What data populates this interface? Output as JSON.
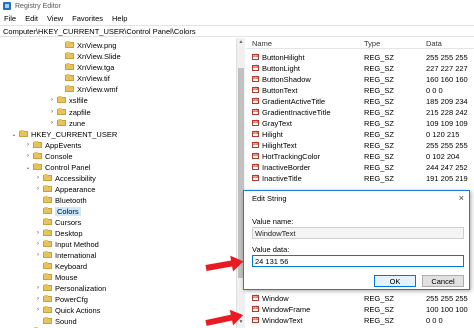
{
  "window": {
    "title": "Registry Editor",
    "accent": "#1e7bd6"
  },
  "menu": [
    "File",
    "Edit",
    "View",
    "Favorites",
    "Help"
  ],
  "address": "Computer\\HKEY_CURRENT_USER\\Control Panel\\Colors",
  "tree": [
    {
      "label": "XnView.png",
      "expand": ""
    },
    {
      "label": "XnView.Slide",
      "expand": ""
    },
    {
      "label": "XnView.tga",
      "expand": ""
    },
    {
      "label": "XnView.tif",
      "expand": ""
    },
    {
      "label": "XnView.wmf",
      "expand": ""
    },
    {
      "label": "xslfile",
      "expand": ">"
    },
    {
      "label": "zapfile",
      "expand": ">"
    },
    {
      "label": "zune",
      "expand": ">"
    },
    {
      "label": "HKEY_CURRENT_USER",
      "expand": "v"
    },
    {
      "label": "AppEvents",
      "expand": ">"
    },
    {
      "label": "Console",
      "expand": ">"
    },
    {
      "label": "Control Panel",
      "expand": "v"
    },
    {
      "label": "Accessibility",
      "expand": ">"
    },
    {
      "label": "Appearance",
      "expand": ">"
    },
    {
      "label": "Bluetooth",
      "expand": ""
    },
    {
      "label": "Colors",
      "expand": "",
      "selected": true
    },
    {
      "label": "Cursors",
      "expand": ""
    },
    {
      "label": "Desktop",
      "expand": ">"
    },
    {
      "label": "Input Method",
      "expand": ">"
    },
    {
      "label": "International",
      "expand": ">"
    },
    {
      "label": "Keyboard",
      "expand": ""
    },
    {
      "label": "Mouse",
      "expand": ""
    },
    {
      "label": "Personalization",
      "expand": ">"
    },
    {
      "label": "PowerCfg",
      "expand": ">"
    },
    {
      "label": "Quick Actions",
      "expand": ">"
    },
    {
      "label": "Sound",
      "expand": ""
    },
    {
      "label": "Environment",
      "expand": ""
    }
  ],
  "list": {
    "headers": {
      "name": "Name",
      "type": "Type",
      "data": "Data"
    },
    "rows": [
      {
        "name": "ButtonHilight",
        "type": "REG_SZ",
        "data": "255 255 255"
      },
      {
        "name": "ButtonLight",
        "type": "REG_SZ",
        "data": "227 227 227"
      },
      {
        "name": "ButtonShadow",
        "type": "REG_SZ",
        "data": "160 160 160"
      },
      {
        "name": "ButtonText",
        "type": "REG_SZ",
        "data": "0 0 0"
      },
      {
        "name": "GradientActiveTitle",
        "type": "REG_SZ",
        "data": "185 209 234"
      },
      {
        "name": "GradientInactiveTitle",
        "type": "REG_SZ",
        "data": "215 228 242"
      },
      {
        "name": "GrayText",
        "type": "REG_SZ",
        "data": "109 109 109"
      },
      {
        "name": "Hilight",
        "type": "REG_SZ",
        "data": "0 120 215"
      },
      {
        "name": "HilightText",
        "type": "REG_SZ",
        "data": "255 255 255"
      },
      {
        "name": "HotTrackingColor",
        "type": "REG_SZ",
        "data": "0 102 204"
      },
      {
        "name": "InactiveBorder",
        "type": "REG_SZ",
        "data": "244 247 252"
      },
      {
        "name": "InactiveTitle",
        "type": "REG_SZ",
        "data": "191 205 219"
      }
    ],
    "bottom_rows": [
      {
        "name": "Window",
        "type": "REG_SZ",
        "data": "255 255 255"
      },
      {
        "name": "WindowFrame",
        "type": "REG_SZ",
        "data": "100 100 100"
      },
      {
        "name": "WindowText",
        "type": "REG_SZ",
        "data": "0 0 0"
      }
    ]
  },
  "dialog": {
    "title": "Edit String",
    "close": "×",
    "value_name_label": "Value name:",
    "value_name": "WindowText",
    "value_data_label": "Value data:",
    "value_data": "24 131 56",
    "ok": "OK",
    "cancel": "Cancel"
  },
  "annotation_color": "#e81b23"
}
